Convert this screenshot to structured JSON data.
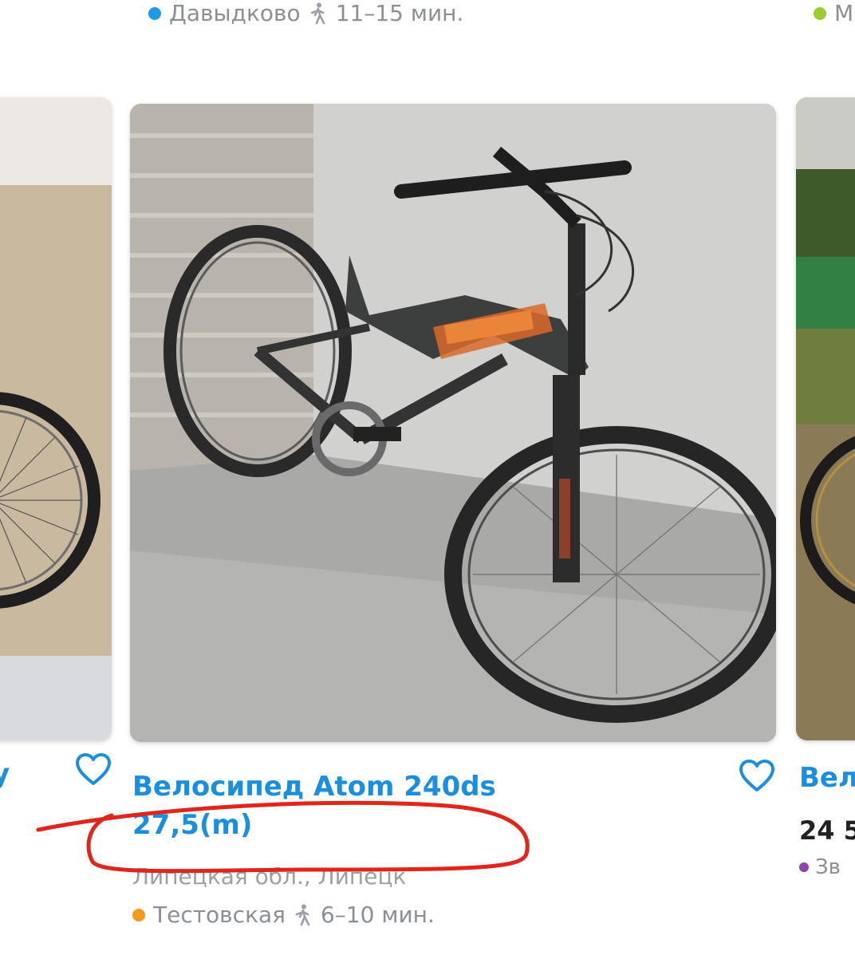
{
  "top_row": {
    "left_metro": {
      "station": "Давыдково",
      "walk_time": "11–15 мин.",
      "color": "#1e9be8"
    },
    "right_metro": {
      "station": "М",
      "color": "#9acd32"
    }
  },
  "left_listing": {
    "title_tail": "у"
  },
  "main_listing": {
    "title": "Велосипед Atom 240ds 27,5(m)",
    "location": "Липецкая обл., Липецк",
    "metro": {
      "station": "Тестовская",
      "walk_time": "6–10 мин.",
      "color": "#f39a1e"
    }
  },
  "right_listing": {
    "title": "Вел",
    "price": "24 5",
    "metro": {
      "station": "Зв",
      "color": "#8e44ad"
    }
  },
  "colors": {
    "link": "#1a8fe0",
    "annotation": "#e0251b"
  },
  "icons": [
    "heart-icon",
    "walk-icon",
    "metro-dot"
  ]
}
